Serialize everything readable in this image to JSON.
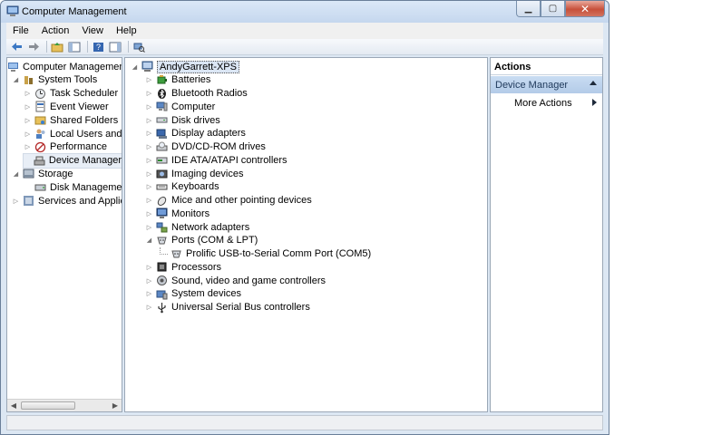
{
  "window": {
    "title": "Computer Management"
  },
  "menu": {
    "items": [
      "File",
      "Action",
      "View",
      "Help"
    ]
  },
  "left_tree": [
    {
      "label": "Computer Management",
      "level": 0,
      "arrow": "",
      "icon": "computer-management-icon"
    },
    {
      "label": "System Tools",
      "level": 1,
      "arrow": "expanded",
      "icon": "system-tools-icon"
    },
    {
      "label": "Task Scheduler",
      "level": 2,
      "arrow": "collapsed",
      "icon": "task-scheduler-icon"
    },
    {
      "label": "Event Viewer",
      "level": 2,
      "arrow": "collapsed",
      "icon": "event-viewer-icon"
    },
    {
      "label": "Shared Folders",
      "level": 2,
      "arrow": "collapsed",
      "icon": "shared-folders-icon"
    },
    {
      "label": "Local Users and Gr",
      "level": 2,
      "arrow": "collapsed",
      "icon": "local-users-icon"
    },
    {
      "label": "Performance",
      "level": 2,
      "arrow": "collapsed",
      "icon": "performance-icon"
    },
    {
      "label": "Device Manager",
      "level": 2,
      "arrow": "",
      "icon": "device-manager-icon",
      "selected": true
    },
    {
      "label": "Storage",
      "level": 1,
      "arrow": "expanded",
      "icon": "storage-icon"
    },
    {
      "label": "Disk Management",
      "level": 2,
      "arrow": "",
      "icon": "disk-management-icon"
    },
    {
      "label": "Services and Applicat",
      "level": 1,
      "arrow": "collapsed",
      "icon": "services-icon"
    }
  ],
  "device_tree": {
    "host": "AndyGarrett-XPS",
    "categories": [
      {
        "label": "Batteries",
        "icon": "battery-icon",
        "expanded": false
      },
      {
        "label": "Bluetooth Radios",
        "icon": "bluetooth-icon",
        "expanded": false
      },
      {
        "label": "Computer",
        "icon": "computer-icon",
        "expanded": false
      },
      {
        "label": "Disk drives",
        "icon": "disk-drive-icon",
        "expanded": false
      },
      {
        "label": "Display adapters",
        "icon": "display-adapter-icon",
        "expanded": false
      },
      {
        "label": "DVD/CD-ROM drives",
        "icon": "dvd-icon",
        "expanded": false
      },
      {
        "label": "IDE ATA/ATAPI controllers",
        "icon": "ide-controller-icon",
        "expanded": false
      },
      {
        "label": "Imaging devices",
        "icon": "imaging-icon",
        "expanded": false
      },
      {
        "label": "Keyboards",
        "icon": "keyboard-icon",
        "expanded": false
      },
      {
        "label": "Mice and other pointing devices",
        "icon": "mouse-icon",
        "expanded": false
      },
      {
        "label": "Monitors",
        "icon": "monitor-icon",
        "expanded": false
      },
      {
        "label": "Network adapters",
        "icon": "network-icon",
        "expanded": false
      },
      {
        "label": "Ports (COM & LPT)",
        "icon": "port-icon",
        "expanded": true,
        "children": [
          {
            "label": "Prolific USB-to-Serial Comm Port (COM5)",
            "icon": "port-icon"
          }
        ]
      },
      {
        "label": "Processors",
        "icon": "processor-icon",
        "expanded": false
      },
      {
        "label": "Sound, video and game controllers",
        "icon": "sound-icon",
        "expanded": false
      },
      {
        "label": "System devices",
        "icon": "system-devices-icon",
        "expanded": false
      },
      {
        "label": "Universal Serial Bus controllers",
        "icon": "usb-icon",
        "expanded": false
      }
    ]
  },
  "actions": {
    "header": "Actions",
    "section": "Device Manager",
    "items": [
      "More Actions"
    ]
  },
  "colors": {
    "selection": "#dbe6f4",
    "actions_section": "#c9dcf2",
    "close_button": "#c7503a"
  }
}
